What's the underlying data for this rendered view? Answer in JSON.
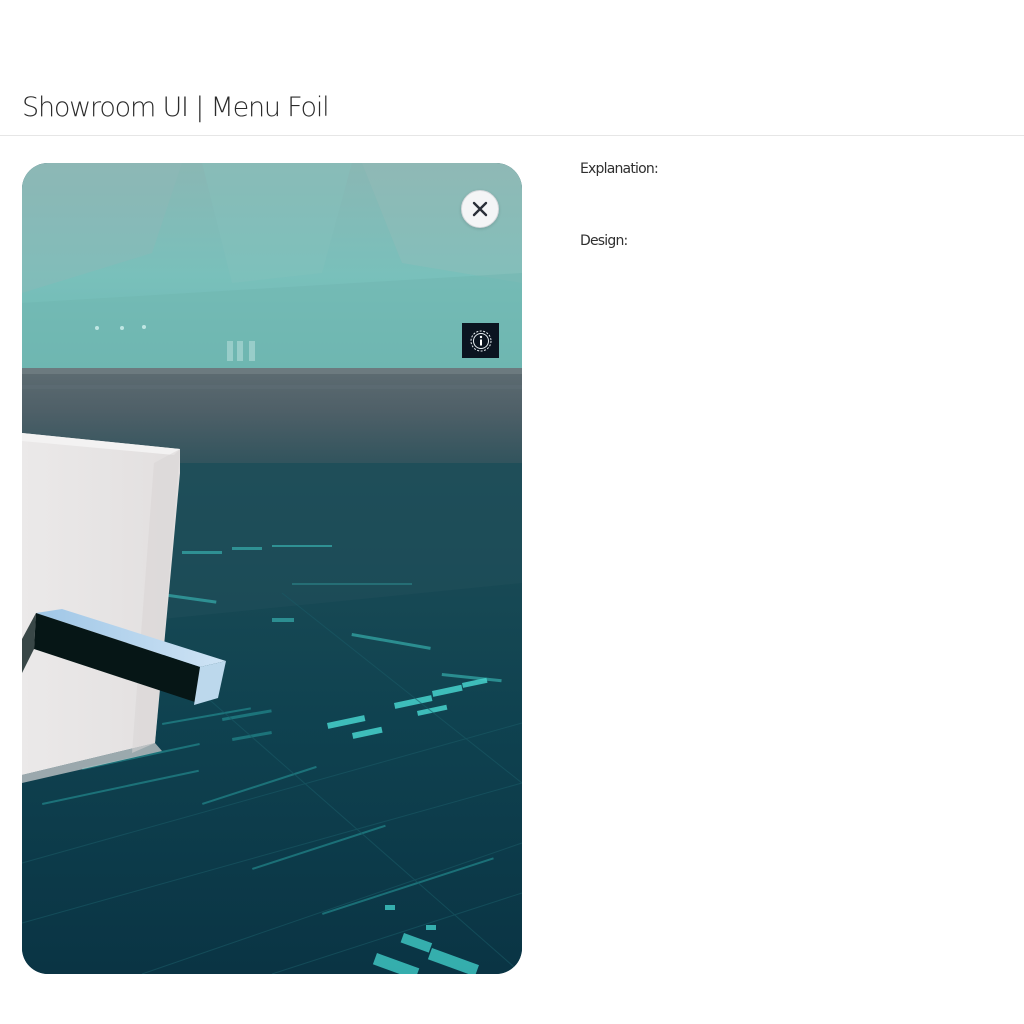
{
  "header": {
    "title": "Showroom UI | Menu Foil"
  },
  "preview": {
    "close_icon": "close-icon",
    "info_icon": "info-icon",
    "colors": {
      "sky": "#7fbfba",
      "floor": "#0f4652",
      "cube": "#e8e6e6",
      "bar": "#061616",
      "accent": "#3fc9c4"
    }
  },
  "details": {
    "explanation_label": "Explanation:",
    "design_label": "Design:"
  }
}
